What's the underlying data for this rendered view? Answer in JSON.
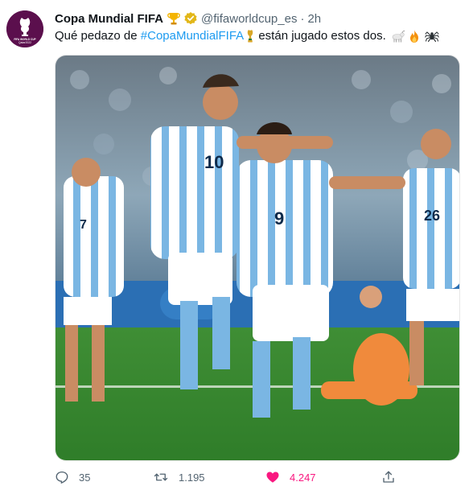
{
  "tweet": {
    "author": {
      "display_name": "Copa Mundial FIFA",
      "handle": "@fifaworldcup_es",
      "avatar_icon": "fifa-world-cup-qatar-2022-logo",
      "avatar_logo_text": "FIFA WORLD CUP Qatar2022"
    },
    "separator": "·",
    "time": "2h",
    "text": {
      "prefix": "Qué pedazo de ",
      "hashtag": "#CopaMundialFIFA",
      "suffix": " están jugado estos dos."
    },
    "media": {
      "jersey_numbers": [
        "10",
        "9",
        "7",
        "26"
      ]
    },
    "stats": {
      "replies": "35",
      "retweets": "1.195",
      "likes": "4.247"
    },
    "colors": {
      "accent_blue": "#1d9bf0",
      "like_pink": "#f91880",
      "secondary_text": "#536471",
      "verified_gold": "#e2b719",
      "avatar_bg": "#5b0f4d"
    }
  }
}
